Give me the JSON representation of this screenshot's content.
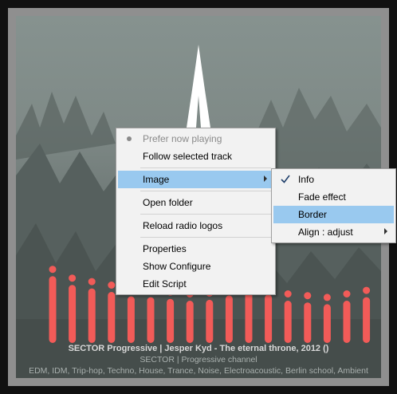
{
  "now_playing": {
    "line1": "SECTOR Progressive | Jesper Kyd - The eternal throne, 2012 ()",
    "line2": "SECTOR  |  Progressive channel",
    "line3": "EDM, IDM, Trip-hop, Techno, House, Trance, Noise, Electroacoustic, Berlin school, Ambient"
  },
  "spectrum": {
    "bar_color": "#f25b58",
    "bar_levels": [
      0.88,
      0.78,
      0.74,
      0.7,
      0.65,
      0.64,
      0.62,
      0.6,
      0.61,
      0.66,
      0.7,
      0.67,
      0.6,
      0.58,
      0.56,
      0.6,
      0.64,
      0.67,
      0.72,
      0.76,
      0.83,
      0.87
    ]
  },
  "context_menu": {
    "items": [
      {
        "label": "Prefer now playing",
        "state": "disabled-selected"
      },
      {
        "label": "Follow selected track"
      },
      {
        "label": "Image",
        "has_submenu": true,
        "highlighted": true
      },
      {
        "label": "Open folder"
      },
      {
        "label": "Reload radio logos"
      },
      {
        "label": "Properties"
      },
      {
        "label": "Show Configure"
      },
      {
        "label": "Edit Script"
      }
    ]
  },
  "image_submenu": {
    "items": [
      {
        "label": "Info",
        "checked": true
      },
      {
        "label": "Fade effect"
      },
      {
        "label": "Border",
        "highlighted": true
      },
      {
        "label": "Align : adjust",
        "has_submenu": true
      }
    ]
  },
  "colors": {
    "highlight": "#99c9ef",
    "menu_bg": "#f2f2f2",
    "frame": "#8f8f8f"
  }
}
